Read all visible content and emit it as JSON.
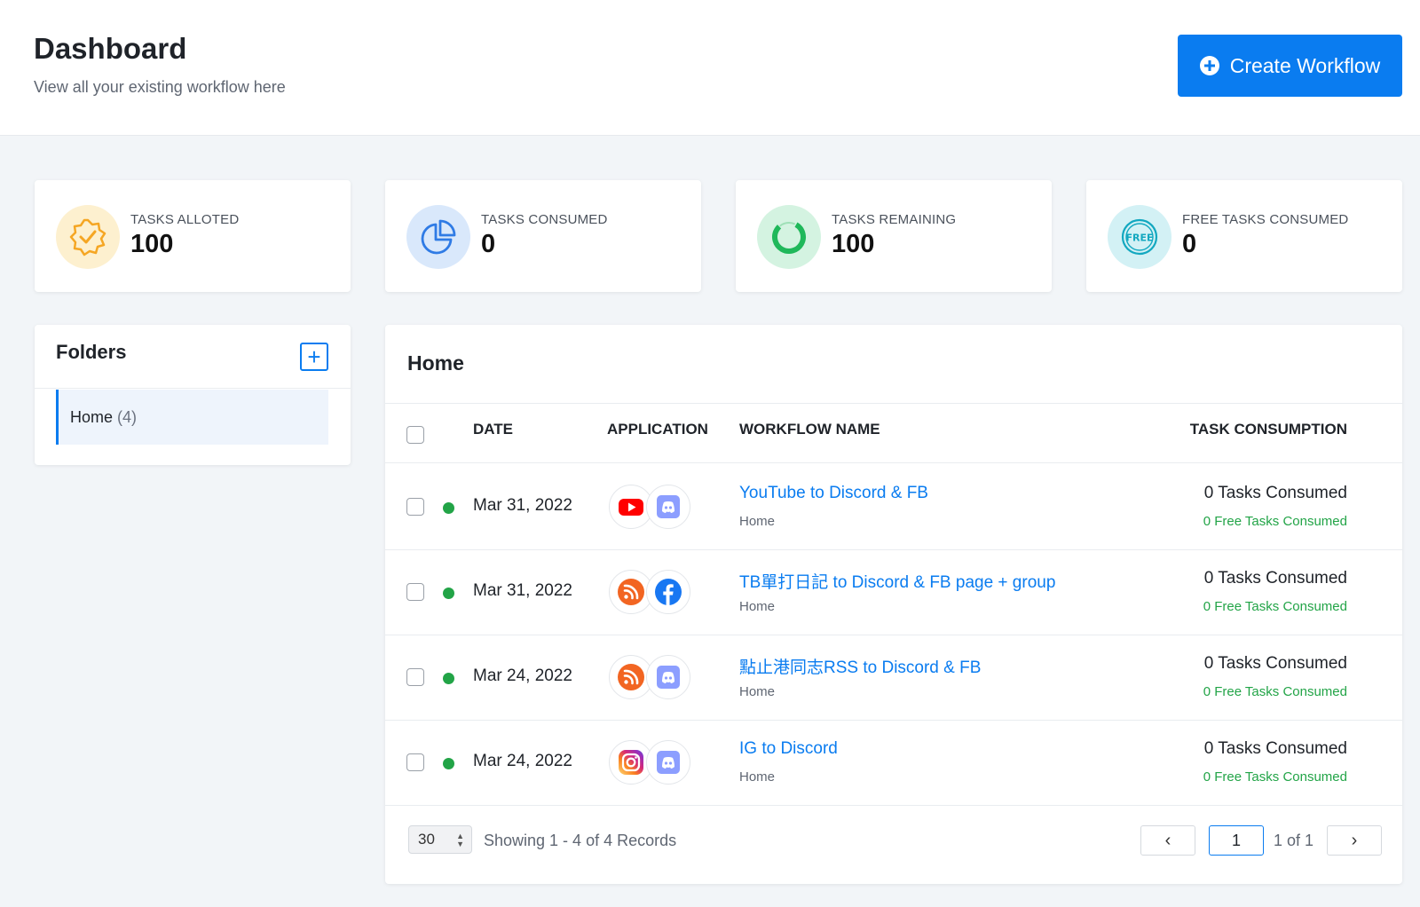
{
  "header": {
    "title": "Dashboard",
    "subtitle": "View all your existing workflow here",
    "create_button": "Create Workflow"
  },
  "stats": [
    {
      "label": "TASKS ALLOTED",
      "value": "100",
      "icon": "badge-check-icon",
      "color": "#f5a623"
    },
    {
      "label": "TASKS CONSUMED",
      "value": "0",
      "icon": "pie-chart-icon",
      "color": "#2f7be5"
    },
    {
      "label": "TASKS REMAINING",
      "value": "100",
      "icon": "progress-ring-icon",
      "color": "#1fb85a"
    },
    {
      "label": "FREE TASKS CONSUMED",
      "value": "0",
      "icon": "free-badge-icon",
      "color": "#13a8c0"
    }
  ],
  "folders": {
    "title": "Folders",
    "items": [
      {
        "name": "Home",
        "count": "(4)"
      }
    ]
  },
  "main": {
    "title": "Home",
    "columns": {
      "date": "DATE",
      "application": "APPLICATION",
      "workflow_name": "WORKFLOW NAME",
      "task_consumption": "TASK CONSUMPTION"
    },
    "rows": [
      {
        "date": "Mar 31, 2022",
        "apps": [
          "youtube-icon",
          "discord-icon"
        ],
        "name": "YouTube to Discord & FB",
        "folder": "Home",
        "consumed": "0 Tasks Consumed",
        "free": "0 Free Tasks Consumed"
      },
      {
        "date": "Mar 31, 2022",
        "apps": [
          "rss-icon",
          "facebook-icon"
        ],
        "name": "TB單打日記 to Discord & FB page + group",
        "folder": "Home",
        "consumed": "0 Tasks Consumed",
        "free": "0 Free Tasks Consumed"
      },
      {
        "date": "Mar 24, 2022",
        "apps": [
          "rss-icon",
          "discord-icon"
        ],
        "name": "點止港同志RSS to Discord & FB",
        "folder": "Home",
        "consumed": "0 Tasks Consumed",
        "free": "0 Free Tasks Consumed"
      },
      {
        "date": "Mar 24, 2022",
        "apps": [
          "instagram-icon",
          "discord-icon"
        ],
        "name": "IG to Discord",
        "folder": "Home",
        "consumed": "0 Tasks Consumed",
        "free": "0 Free Tasks Consumed"
      }
    ],
    "footer": {
      "per_page": "30",
      "showing": "Showing 1 - 4 of 4 Records",
      "page": "1",
      "page_of": "1 of 1"
    }
  }
}
